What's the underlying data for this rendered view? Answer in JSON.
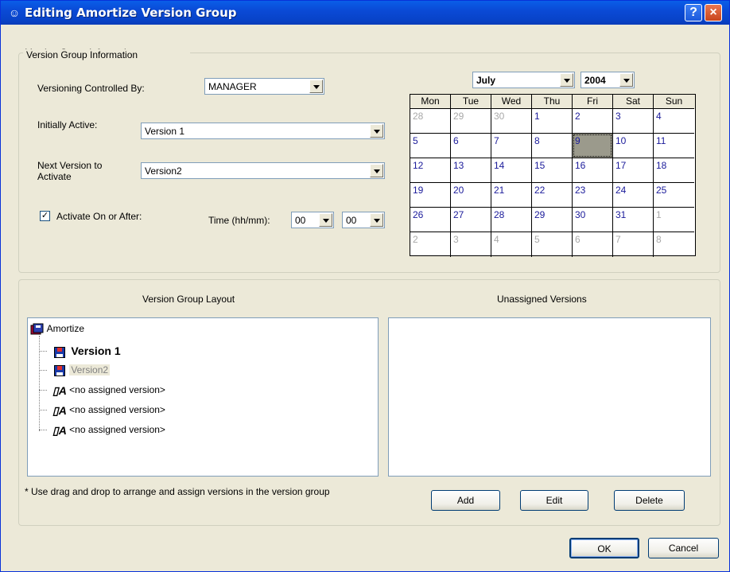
{
  "window": {
    "title": "Editing Amortize Version Group",
    "help": "?",
    "close": "×"
  },
  "info_group": {
    "legend": "Version Group Information",
    "controlled_by_label": "Versioning Controlled By:",
    "controlled_by_value": "MANAGER",
    "initially_active_label": "Initially Active:",
    "initially_active_value": "Version 1",
    "next_version_label": "Next Version to Activate",
    "next_version_value": "Version2",
    "activate_check": "✓",
    "activate_label": "Activate On or After:",
    "time_label": "Time (hh/mm):",
    "hour": "00",
    "minute": "00"
  },
  "calendar": {
    "month": "July",
    "year": "2004",
    "days": [
      "Mon",
      "Tue",
      "Wed",
      "Thu",
      "Fri",
      "Sat",
      "Sun"
    ],
    "weeks": [
      [
        "28",
        "29",
        "30",
        "1",
        "2",
        "3",
        "4"
      ],
      [
        "5",
        "6",
        "7",
        "8",
        "9",
        "10",
        "11"
      ],
      [
        "12",
        "13",
        "14",
        "15",
        "16",
        "17",
        "18"
      ],
      [
        "19",
        "20",
        "21",
        "22",
        "23",
        "24",
        "25"
      ],
      [
        "26",
        "27",
        "28",
        "29",
        "30",
        "31",
        "1"
      ],
      [
        "2",
        "3",
        "4",
        "5",
        "6",
        "7",
        "8"
      ]
    ],
    "selected_day": "9"
  },
  "layout_group": {
    "layout_header": "Version Group Layout",
    "unassigned_header": "Unassigned Versions",
    "tree": {
      "root": "Amortize",
      "items": [
        "Version 1",
        "Version2",
        "<no assigned version>",
        "<no assigned version>",
        "<no assigned version>"
      ]
    },
    "hint": "* Use drag and drop to arrange and assign versions in the version group",
    "add": "Add",
    "edit": "Edit",
    "delete": "Delete"
  },
  "footer": {
    "ok": "OK",
    "cancel": "Cancel"
  }
}
